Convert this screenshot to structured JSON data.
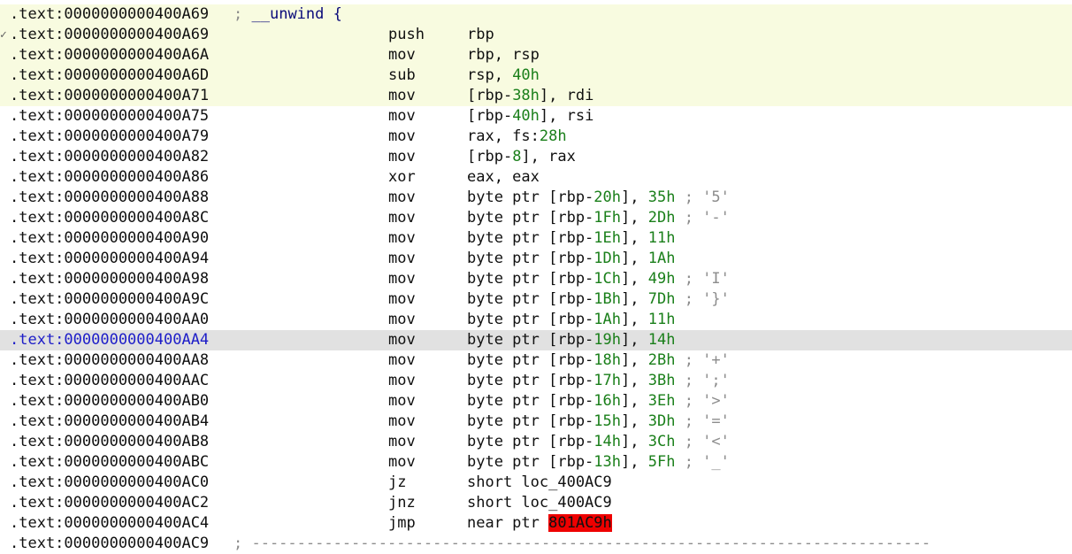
{
  "header": {
    "address": ".text:0000000000400A69",
    "comment_prefix": ";",
    "comment_text": "__unwind {"
  },
  "lines": [
    {
      "address": ".text:0000000000400A69",
      "marker": "✓",
      "mnemonic": "push",
      "operands": [
        {
          "t": "rbp",
          "c": "t"
        }
      ]
    },
    {
      "address": ".text:0000000000400A6A",
      "mnemonic": "mov",
      "operands": [
        {
          "t": "rbp, rsp",
          "c": "t"
        }
      ]
    },
    {
      "address": ".text:0000000000400A6D",
      "mnemonic": "sub",
      "operands": [
        {
          "t": "rsp, ",
          "c": "t"
        },
        {
          "t": "40h",
          "c": "n"
        }
      ]
    },
    {
      "address": ".text:0000000000400A71",
      "mnemonic": "mov",
      "operands": [
        {
          "t": "[rbp-",
          "c": "t"
        },
        {
          "t": "38h",
          "c": "n"
        },
        {
          "t": "], rdi",
          "c": "t"
        }
      ]
    },
    {
      "address": ".text:0000000000400A75",
      "mnemonic": "mov",
      "operands": [
        {
          "t": "[rbp-",
          "c": "t"
        },
        {
          "t": "40h",
          "c": "n"
        },
        {
          "t": "], rsi",
          "c": "t"
        }
      ]
    },
    {
      "address": ".text:0000000000400A79",
      "mnemonic": "mov",
      "operands": [
        {
          "t": "rax, fs:",
          "c": "t"
        },
        {
          "t": "28h",
          "c": "n"
        }
      ]
    },
    {
      "address": ".text:0000000000400A82",
      "mnemonic": "mov",
      "operands": [
        {
          "t": "[rbp-",
          "c": "t"
        },
        {
          "t": "8",
          "c": "n"
        },
        {
          "t": "], rax",
          "c": "t"
        }
      ]
    },
    {
      "address": ".text:0000000000400A86",
      "mnemonic": "xor",
      "operands": [
        {
          "t": "eax, eax",
          "c": "t"
        }
      ]
    },
    {
      "address": ".text:0000000000400A88",
      "mnemonic": "mov",
      "operands": [
        {
          "t": "byte ptr [rbp-",
          "c": "t"
        },
        {
          "t": "20h",
          "c": "n"
        },
        {
          "t": "], ",
          "c": "t"
        },
        {
          "t": "35h",
          "c": "n"
        },
        {
          "t": " ; '5'",
          "c": "c"
        }
      ]
    },
    {
      "address": ".text:0000000000400A8C",
      "mnemonic": "mov",
      "operands": [
        {
          "t": "byte ptr [rbp-",
          "c": "t"
        },
        {
          "t": "1Fh",
          "c": "n"
        },
        {
          "t": "], ",
          "c": "t"
        },
        {
          "t": "2Dh",
          "c": "n"
        },
        {
          "t": " ; '-'",
          "c": "c"
        }
      ]
    },
    {
      "address": ".text:0000000000400A90",
      "mnemonic": "mov",
      "operands": [
        {
          "t": "byte ptr [rbp-",
          "c": "t"
        },
        {
          "t": "1Eh",
          "c": "n"
        },
        {
          "t": "], ",
          "c": "t"
        },
        {
          "t": "11h",
          "c": "n"
        }
      ]
    },
    {
      "address": ".text:0000000000400A94",
      "mnemonic": "mov",
      "operands": [
        {
          "t": "byte ptr [rbp-",
          "c": "t"
        },
        {
          "t": "1Dh",
          "c": "n"
        },
        {
          "t": "], ",
          "c": "t"
        },
        {
          "t": "1Ah",
          "c": "n"
        }
      ]
    },
    {
      "address": ".text:0000000000400A98",
      "mnemonic": "mov",
      "operands": [
        {
          "t": "byte ptr [rbp-",
          "c": "t"
        },
        {
          "t": "1Ch",
          "c": "n"
        },
        {
          "t": "], ",
          "c": "t"
        },
        {
          "t": "49h",
          "c": "n"
        },
        {
          "t": " ; 'I'",
          "c": "c"
        }
      ]
    },
    {
      "address": ".text:0000000000400A9C",
      "mnemonic": "mov",
      "operands": [
        {
          "t": "byte ptr [rbp-",
          "c": "t"
        },
        {
          "t": "1Bh",
          "c": "n"
        },
        {
          "t": "], ",
          "c": "t"
        },
        {
          "t": "7Dh",
          "c": "n"
        },
        {
          "t": " ; '}'",
          "c": "c"
        }
      ]
    },
    {
      "address": ".text:0000000000400AA0",
      "mnemonic": "mov",
      "operands": [
        {
          "t": "byte ptr [rbp-",
          "c": "t"
        },
        {
          "t": "1Ah",
          "c": "n"
        },
        {
          "t": "], ",
          "c": "t"
        },
        {
          "t": "11h",
          "c": "n"
        }
      ]
    },
    {
      "address": ".text:0000000000400AA4",
      "mnemonic": "mov",
      "current": true,
      "operands": [
        {
          "t": "byte ptr [rbp-",
          "c": "t"
        },
        {
          "t": "19h",
          "c": "n"
        },
        {
          "t": "], ",
          "c": "t"
        },
        {
          "t": "14h",
          "c": "n"
        }
      ]
    },
    {
      "address": ".text:0000000000400AA8",
      "mnemonic": "mov",
      "operands": [
        {
          "t": "byte ptr [rbp-",
          "c": "t"
        },
        {
          "t": "18h",
          "c": "n"
        },
        {
          "t": "], ",
          "c": "t"
        },
        {
          "t": "2Bh",
          "c": "n"
        },
        {
          "t": " ; '+'",
          "c": "c"
        }
      ]
    },
    {
      "address": ".text:0000000000400AAC",
      "mnemonic": "mov",
      "operands": [
        {
          "t": "byte ptr [rbp-",
          "c": "t"
        },
        {
          "t": "17h",
          "c": "n"
        },
        {
          "t": "], ",
          "c": "t"
        },
        {
          "t": "3Bh",
          "c": "n"
        },
        {
          "t": " ; ';'",
          "c": "c"
        }
      ]
    },
    {
      "address": ".text:0000000000400AB0",
      "mnemonic": "mov",
      "operands": [
        {
          "t": "byte ptr [rbp-",
          "c": "t"
        },
        {
          "t": "16h",
          "c": "n"
        },
        {
          "t": "], ",
          "c": "t"
        },
        {
          "t": "3Eh",
          "c": "n"
        },
        {
          "t": " ; '>'",
          "c": "c"
        }
      ]
    },
    {
      "address": ".text:0000000000400AB4",
      "mnemonic": "mov",
      "operands": [
        {
          "t": "byte ptr [rbp-",
          "c": "t"
        },
        {
          "t": "15h",
          "c": "n"
        },
        {
          "t": "], ",
          "c": "t"
        },
        {
          "t": "3Dh",
          "c": "n"
        },
        {
          "t": " ; '='",
          "c": "c"
        }
      ]
    },
    {
      "address": ".text:0000000000400AB8",
      "mnemonic": "mov",
      "operands": [
        {
          "t": "byte ptr [rbp-",
          "c": "t"
        },
        {
          "t": "14h",
          "c": "n"
        },
        {
          "t": "], ",
          "c": "t"
        },
        {
          "t": "3Ch",
          "c": "n"
        },
        {
          "t": " ; '<'",
          "c": "c"
        }
      ]
    },
    {
      "address": ".text:0000000000400ABC",
      "mnemonic": "mov",
      "operands": [
        {
          "t": "byte ptr [rbp-",
          "c": "t"
        },
        {
          "t": "13h",
          "c": "n"
        },
        {
          "t": "], ",
          "c": "t"
        },
        {
          "t": "5Fh",
          "c": "n"
        },
        {
          "t": " ; '_'",
          "c": "c"
        }
      ]
    },
    {
      "address": ".text:0000000000400AC0",
      "mnemonic": "jz",
      "operands": [
        {
          "t": "short loc_400AC9",
          "c": "t"
        }
      ]
    },
    {
      "address": ".text:0000000000400AC2",
      "mnemonic": "jnz",
      "operands": [
        {
          "t": "short loc_400AC9",
          "c": "t"
        }
      ]
    },
    {
      "address": ".text:0000000000400AC4",
      "mnemonic": "jmp",
      "operands": [
        {
          "t": "near ptr ",
          "c": "t"
        },
        {
          "t": "801AC9h",
          "c": "r"
        }
      ]
    }
  ],
  "separator": {
    "address": ".text:0000000000400AC9",
    "text": "; ---------------------------------------------------------------------------"
  },
  "colors": {
    "function_background": "#f8fbe0",
    "current_line_background": "#e1e1e1",
    "current_address": "#1d1dc8",
    "number": "#1a7f1a",
    "comment": "#8c8c8c",
    "error_highlight": "#ee0000"
  }
}
